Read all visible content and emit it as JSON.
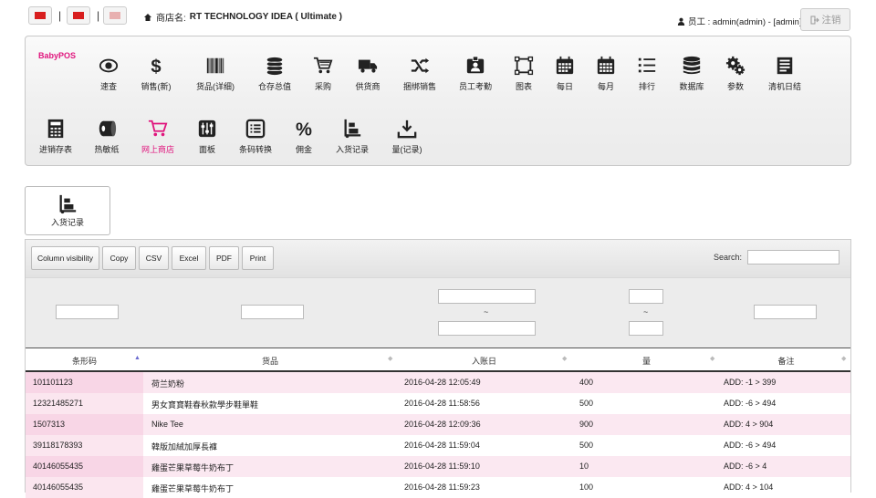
{
  "header": {
    "shop_label": "商店名:",
    "shop_name": "RT TECHNOLOGY IDEA ( Ultimate )",
    "staff_label": "员工 : admin(admin) - [admin]",
    "logout_label": "注销",
    "flag_colors": [
      "#d81e1e",
      "#d81e1e",
      "#e8b0b0"
    ],
    "separators": [
      "|",
      "|"
    ]
  },
  "brand": {
    "name": "BabyPOS",
    "color": "#e0157d"
  },
  "menu_row1": [
    {
      "label": "速查",
      "icon": "eye-icon"
    },
    {
      "label": "销售(新)",
      "icon": "dollar-icon"
    },
    {
      "label": "货品(详细)",
      "icon": "barcode-icon"
    },
    {
      "label": "仓存总值",
      "icon": "coins-icon"
    },
    {
      "label": "采购",
      "icon": "cart-icon"
    },
    {
      "label": "供货商",
      "icon": "truck-icon"
    },
    {
      "label": "捆绑销售",
      "icon": "shuffle-icon"
    },
    {
      "label": "员工考勤",
      "icon": "id-badge-icon"
    },
    {
      "label": "图表",
      "icon": "chart-frame-icon"
    },
    {
      "label": "每日",
      "icon": "calendar-icon"
    },
    {
      "label": "每月",
      "icon": "calendar-month-icon"
    },
    {
      "label": "排行",
      "icon": "list-icon"
    },
    {
      "label": "数据库",
      "icon": "database-icon"
    },
    {
      "label": "参数",
      "icon": "gears-icon"
    },
    {
      "label": "清机日结",
      "icon": "ledger-icon"
    }
  ],
  "menu_row2": [
    {
      "label": "进销存表",
      "icon": "calculator-icon"
    },
    {
      "label": "热敏纸",
      "icon": "paper-roll-icon"
    },
    {
      "label": "网上商店",
      "icon": "shop-cart-icon",
      "active": true
    },
    {
      "label": "面板",
      "icon": "sliders-icon"
    },
    {
      "label": "条码转换",
      "icon": "list-box-icon"
    },
    {
      "label": "佣金",
      "icon": "percent-icon"
    },
    {
      "label": "入货记录",
      "icon": "hand-truck-icon"
    },
    {
      "label": "量(记录)",
      "icon": "download-box-icon"
    }
  ],
  "active_tab": {
    "label": "入货记录",
    "icon": "hand-truck-icon"
  },
  "toolbar": {
    "buttons": [
      "Column visibility",
      "Copy",
      "CSV",
      "Excel",
      "PDF",
      "Print"
    ],
    "search_label": "Search:"
  },
  "filters": {
    "range_separators": [
      "~",
      "~"
    ]
  },
  "table": {
    "columns": [
      "条形码",
      "货品",
      "入账日",
      "量",
      "备注"
    ],
    "rows": [
      [
        "101101123",
        "荷兰奶粉",
        "2016-04-28 12:05:49",
        "400",
        "ADD: -1 > 399"
      ],
      [
        "12321485271",
        "男女寶寶鞋春秋款學步鞋單鞋",
        "2016-04-28 11:58:56",
        "500",
        "ADD: -6 > 494"
      ],
      [
        "1507313",
        "Nike Tee",
        "2016-04-28 12:09:36",
        "900",
        "ADD: 4 > 904"
      ],
      [
        "39118178393",
        "韓版加絨加厚長褲",
        "2016-04-28 11:59:04",
        "500",
        "ADD: -6 > 494"
      ],
      [
        "40146055435",
        "雞蛋芒果草莓牛奶布丁",
        "2016-04-28 11:59:10",
        "10",
        "ADD: -6 > 4"
      ],
      [
        "40146055435",
        "雞蛋芒果草莓牛奶布丁",
        "2016-04-28 11:59:23",
        "100",
        "ADD: 4 > 104"
      ]
    ]
  }
}
